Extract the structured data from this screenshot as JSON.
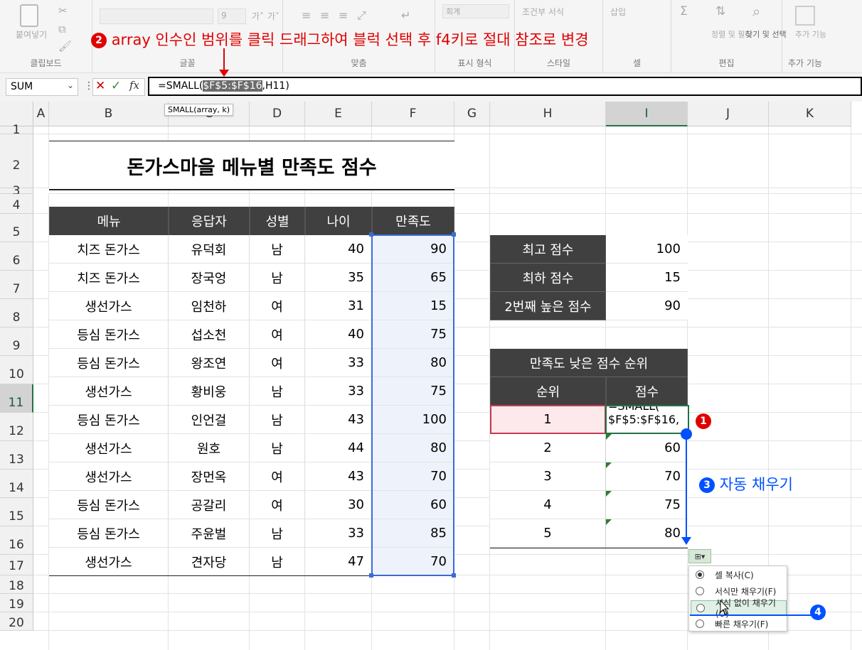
{
  "ribbon": {
    "groups": [
      {
        "label": "클립보드",
        "items": [
          "붙여넣기"
        ]
      },
      {
        "label": "글꼴",
        "items": [
          "9",
          "가˄",
          "가˅"
        ]
      },
      {
        "label": "맞춤",
        "items": []
      },
      {
        "label": "표시 형식",
        "items": [
          "회계"
        ]
      },
      {
        "label": "스타일",
        "items": [
          "조건부 서식"
        ]
      },
      {
        "label": "셀",
        "items": [
          "삽입"
        ]
      },
      {
        "label": "편집",
        "items": [
          "정렬 및 필터",
          "찾기 및 선택"
        ]
      },
      {
        "label": "추가 기능",
        "items": [
          "추가 기능"
        ]
      }
    ]
  },
  "formula_bar": {
    "name_box": "SUM",
    "formula_prefix": "=SMALL(",
    "formula_highlight": "$F$5:$F$16",
    "formula_suffix": ",H11)",
    "tooltip": "SMALL(array, k)"
  },
  "columns": [
    "A",
    "B",
    "C",
    "D",
    "E",
    "F",
    "G",
    "H",
    "I",
    "J",
    "K"
  ],
  "rows": [
    "1",
    "2",
    "3",
    "4",
    "5",
    "6",
    "7",
    "8",
    "9",
    "10",
    "11",
    "12",
    "13",
    "14",
    "15",
    "16",
    "17",
    "18",
    "19",
    "20"
  ],
  "title": "돈가스마을 메뉴별 만족도 점수",
  "table": {
    "headers": [
      "메뉴",
      "응답자",
      "성별",
      "나이",
      "만족도"
    ],
    "rows": [
      [
        "치즈 돈가스",
        "유덕회",
        "남",
        "40",
        "90"
      ],
      [
        "치즈 돈가스",
        "장국엉",
        "남",
        "35",
        "65"
      ],
      [
        "생선가스",
        "임천하",
        "여",
        "31",
        "15"
      ],
      [
        "등심 돈가스",
        "섭소천",
        "여",
        "40",
        "75"
      ],
      [
        "등심 돈가스",
        "왕조연",
        "여",
        "33",
        "80"
      ],
      [
        "생선가스",
        "황비웅",
        "남",
        "33",
        "75"
      ],
      [
        "등심 돈가스",
        "인언걸",
        "남",
        "43",
        "100"
      ],
      [
        "생선가스",
        "원호",
        "남",
        "44",
        "80"
      ],
      [
        "생선가스",
        "장먼옥",
        "여",
        "43",
        "70"
      ],
      [
        "등심 돈가스",
        "공갈리",
        "여",
        "30",
        "60"
      ],
      [
        "등심 돈가스",
        "주윤벌",
        "남",
        "33",
        "85"
      ],
      [
        "생선가스",
        "견자당",
        "남",
        "47",
        "70"
      ]
    ]
  },
  "stats": [
    {
      "label": "최고 점수",
      "value": "100"
    },
    {
      "label": "최하 점수",
      "value": "15"
    },
    {
      "label": "2번째 높은 점수",
      "value": "90"
    }
  ],
  "rank_table": {
    "title": "만족도 낮은 점수 순위",
    "headers": [
      "순위",
      "점수"
    ],
    "edit_cell_line1": "=SMALL(",
    "edit_cell_line2": "$F$5:$F$16,",
    "rows": [
      {
        "rank": "1",
        "score": ""
      },
      {
        "rank": "2",
        "score": "60"
      },
      {
        "rank": "3",
        "score": "70"
      },
      {
        "rank": "4",
        "score": "75"
      },
      {
        "rank": "5",
        "score": "80"
      }
    ]
  },
  "annotations": {
    "step1": "1",
    "step2_badge": "2",
    "step2_text": "array 인수인 범위를 클릭 드래그하여 블럭 선택 후 f4키로 절대 참조로 변경",
    "step3_badge": "3",
    "step3_text": "자동 채우기",
    "step4": "4"
  },
  "autofill_menu": {
    "items": [
      "셀 복사(C)",
      "서식만 채우기(F)",
      "서식 없이 채우기(O)",
      "빠른 채우기(F)"
    ],
    "checked_index": 0,
    "hover_index": 2
  },
  "colors": {
    "accent_red": "#e00000",
    "accent_blue": "#0050ff",
    "header_dark": "#404040",
    "excel_green": "#217346"
  }
}
